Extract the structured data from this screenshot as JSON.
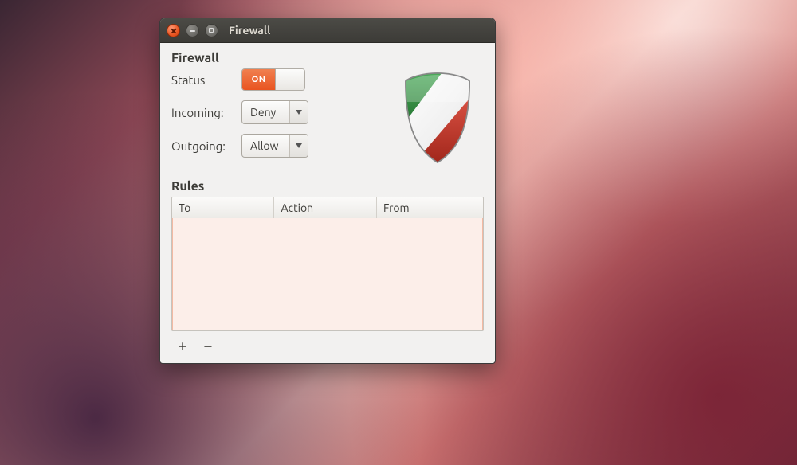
{
  "window": {
    "title": "Firewall"
  },
  "panel": {
    "title": "Firewall",
    "status_label": "Status",
    "status_toggle_text": "ON",
    "incoming_label": "Incoming:",
    "incoming_value": "Deny",
    "outgoing_label": "Outgoing:",
    "outgoing_value": "Allow"
  },
  "rules": {
    "title": "Rules",
    "columns": {
      "to": "To",
      "action": "Action",
      "from": "From"
    },
    "rows": []
  },
  "icons": {
    "close": "close-icon",
    "minimize": "minimize-icon",
    "maximize": "maximize-icon",
    "shield": "shield-icon",
    "dropdown": "chevron-down-icon",
    "add": "plus-icon",
    "remove": "minus-icon"
  },
  "colors": {
    "accent": "#e95420",
    "shield_green": "#2e8b3d",
    "shield_red": "#c0392b",
    "window_bg": "#f2f1f0"
  }
}
